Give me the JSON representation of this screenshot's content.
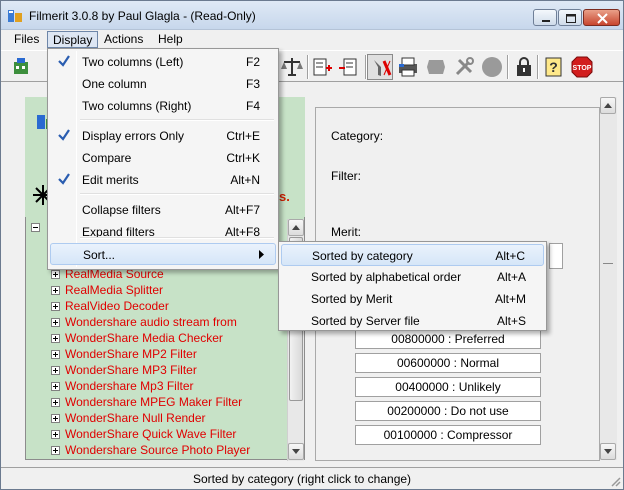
{
  "window": {
    "title": "Filmerit 3.0.8 by Paul Glagla - (Read-Only)"
  },
  "menubar": {
    "files": "Files",
    "display": "Display",
    "actions": "Actions",
    "help": "Help"
  },
  "display_menu": {
    "items": [
      {
        "label": "Two columns (Left)",
        "shortcut": "F2",
        "checked": true
      },
      {
        "label": "One column",
        "shortcut": "F3",
        "checked": false
      },
      {
        "label": "Two columns (Right)",
        "shortcut": "F4",
        "checked": false
      },
      {
        "label": "Display errors Only",
        "shortcut": "Ctrl+E",
        "checked": true
      },
      {
        "label": "Compare",
        "shortcut": "Ctrl+K",
        "checked": false
      },
      {
        "label": "Edit merits",
        "shortcut": "Alt+N",
        "checked": true
      },
      {
        "label": "Collapse filters",
        "shortcut": "Alt+F7",
        "checked": false
      },
      {
        "label": "Expand filters",
        "shortcut": "Alt+F8",
        "checked": false
      },
      {
        "label": "Sort...",
        "shortcut": "",
        "checked": false
      }
    ]
  },
  "sort_submenu": {
    "items": [
      {
        "label": "Sorted by category",
        "shortcut": "Alt+C"
      },
      {
        "label": "Sorted by alphabetical order",
        "shortcut": "Alt+A"
      },
      {
        "label": "Sorted by Merit",
        "shortcut": "Alt+M"
      },
      {
        "label": "Sorted by Server file",
        "shortcut": "Alt+S"
      }
    ]
  },
  "tree": {
    "items": [
      "RealMedia Source",
      "RealMedia Splitter",
      "RealVideo Decoder",
      "Wondershare audio stream from",
      "WonderShare Media Checker",
      "WonderShare MP2 Filter",
      "WonderShare MP3 Filter",
      "Wondershare Mp3 Filter",
      "Wondershare MPEG Maker Filter",
      "WonderShare Null Render",
      "WonderShare Quick Wave Filter",
      "Wondershare Source Photo Player"
    ],
    "partial_text": "s."
  },
  "right_panel": {
    "category_label": "Category:",
    "filter_label": "Filter:",
    "merit_label": "Merit:",
    "merit_options": [
      "00800000 : Preferred",
      "00600000 : Normal",
      "00400000 : Unlikely",
      "00200000 : Do not use",
      "00100000 : Compressor"
    ]
  },
  "statusbar": {
    "text": "Sorted by category (right click to change)"
  },
  "colors": {
    "tree_text": "#e00000",
    "pane_bg": "#c7e2c7",
    "highlight": "#d6e6f8"
  }
}
